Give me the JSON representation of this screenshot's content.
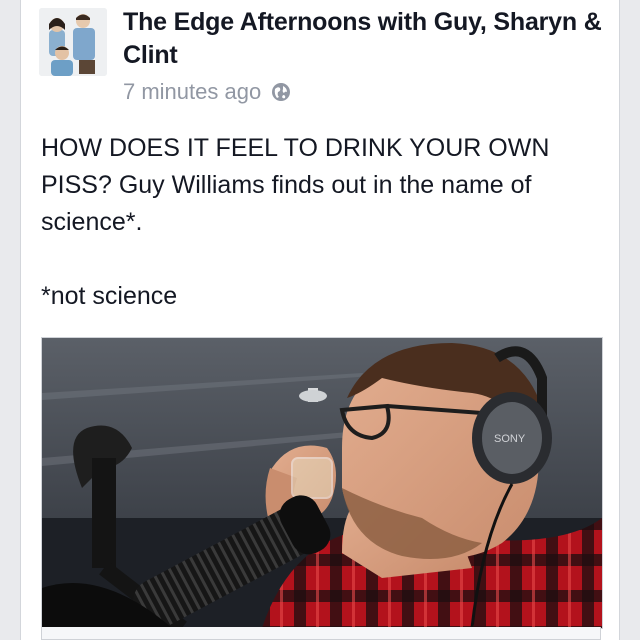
{
  "post": {
    "page_name": "The Edge Afternoons with Guy, Sharyn & Clint",
    "timestamp": "7 minutes ago",
    "privacy_icon": "globe-icon",
    "text_lines": [
      "HOW DOES IT FEEL TO DRINK YOUR OWN PISS? Guy Williams finds out in the name of science*.",
      "*not science"
    ]
  },
  "media": {
    "headphone_brand": "SONY"
  },
  "colors": {
    "page_background": "#e9eaed",
    "card_background": "#ffffff",
    "name_text": "#141823",
    "meta_text": "#9197a3",
    "shirt_red": "#b3121c"
  }
}
